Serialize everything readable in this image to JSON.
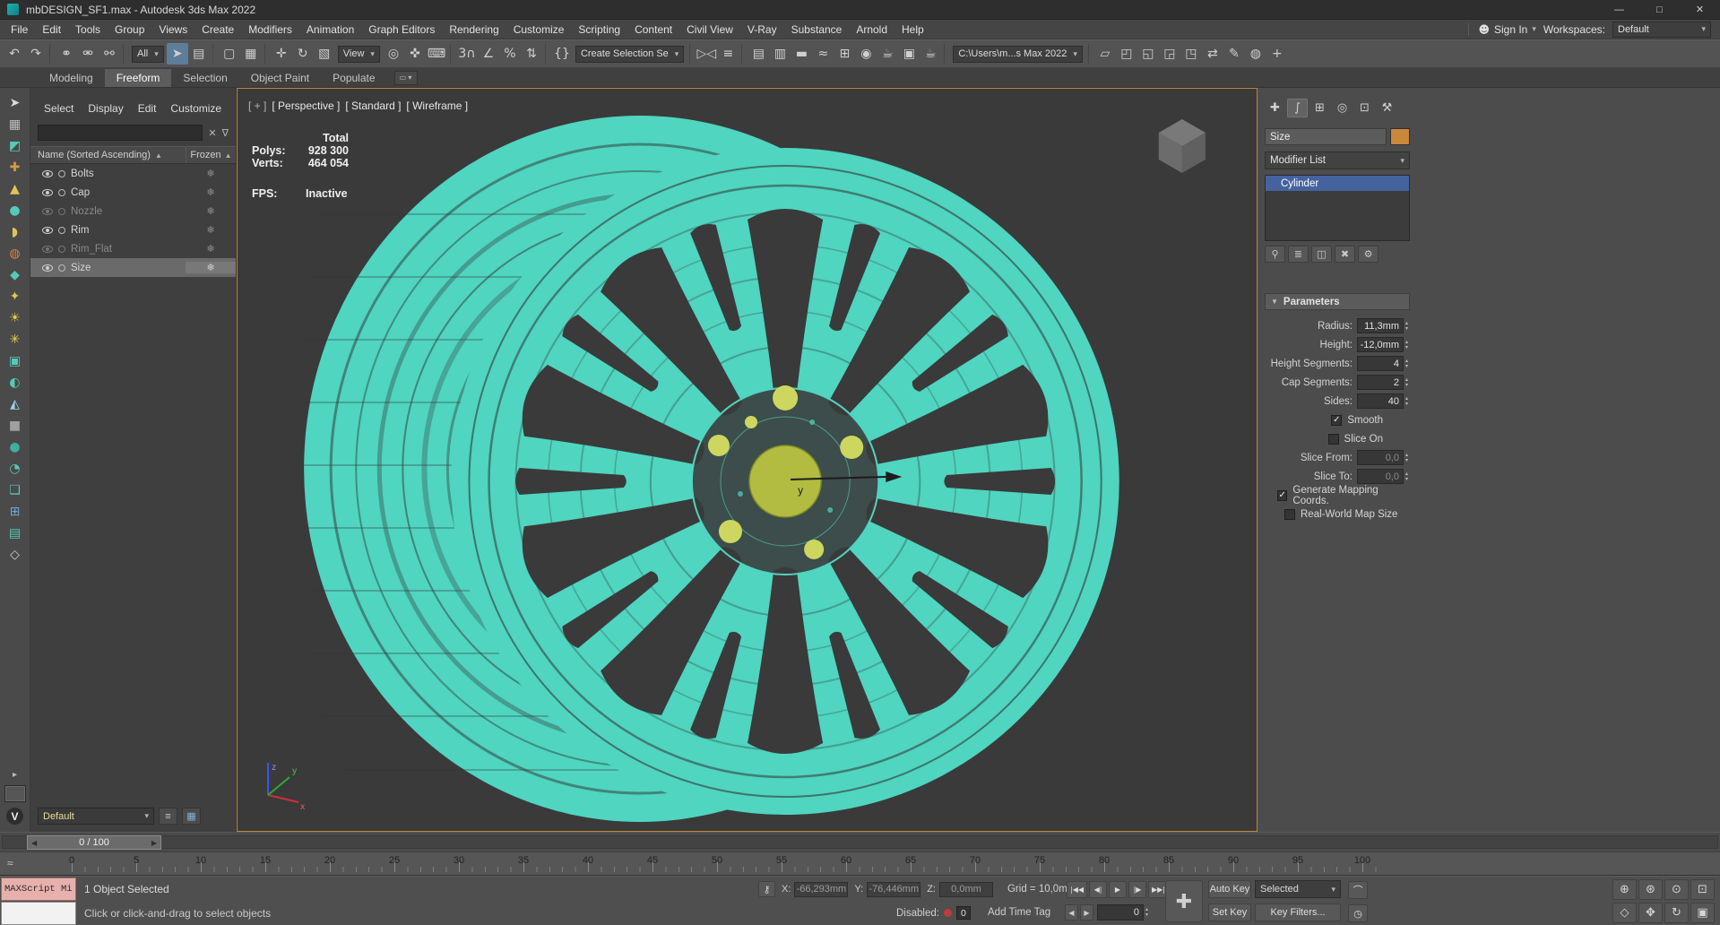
{
  "colors": {
    "accent_teal": "#4fd5c0",
    "object_yellow": "#b2bc40",
    "selection_blue": "#44639e",
    "viewport_border": "#b9893c",
    "listener_pink": "#e8b0ac"
  },
  "window": {
    "title": "mbDESIGN_SF1.max - Autodesk 3ds Max 2022",
    "minimize": "—",
    "maximize": "□",
    "close": "✕"
  },
  "menubar": {
    "items": [
      {
        "n": "menu-file",
        "label": "File"
      },
      {
        "n": "menu-edit",
        "label": "Edit"
      },
      {
        "n": "menu-tools",
        "label": "Tools"
      },
      {
        "n": "menu-group",
        "label": "Group"
      },
      {
        "n": "menu-views",
        "label": "Views"
      },
      {
        "n": "menu-create",
        "label": "Create"
      },
      {
        "n": "menu-modifiers",
        "label": "Modifiers"
      },
      {
        "n": "menu-animation",
        "label": "Animation"
      },
      {
        "n": "menu-graph-editors",
        "label": "Graph Editors"
      },
      {
        "n": "menu-rendering",
        "label": "Rendering"
      },
      {
        "n": "menu-customize",
        "label": "Customize"
      },
      {
        "n": "menu-scripting",
        "label": "Scripting"
      },
      {
        "n": "menu-content",
        "label": "Content"
      },
      {
        "n": "menu-civil-view",
        "label": "Civil View"
      },
      {
        "n": "menu-vray",
        "label": "V-Ray"
      },
      {
        "n": "menu-substance",
        "label": "Substance"
      },
      {
        "n": "menu-arnold",
        "label": "Arnold"
      },
      {
        "n": "menu-help",
        "label": "Help"
      }
    ],
    "signin_label": "Sign In",
    "workspaces_label": "Workspaces:",
    "workspace_value": "Default"
  },
  "toolbar": {
    "items": [
      {
        "n": "undo-icon",
        "g": "↶"
      },
      {
        "n": "redo-icon",
        "g": "↷"
      },
      {
        "sep": "|"
      },
      {
        "n": "select-and-link-icon",
        "g": "⚭"
      },
      {
        "n": "unlink-selection-icon",
        "g": "⚮"
      },
      {
        "n": "bind-to-space-warp-icon",
        "g": "⚯"
      },
      {
        "sep": "|"
      },
      {
        "n": "selection-filter-dropdown",
        "dd": "All"
      },
      {
        "n": "select-object-icon",
        "g": "➤",
        "cls": "active"
      },
      {
        "n": "select-by-name-icon",
        "g": "▤"
      },
      {
        "sep": "|"
      },
      {
        "n": "rectangular-selection-region-icon",
        "g": "▢"
      },
      {
        "n": "window-crossing-toggle-icon",
        "g": "▦"
      },
      {
        "sep": "|"
      },
      {
        "n": "select-and-move-icon",
        "g": "✛"
      },
      {
        "n": "select-and-rotate-icon",
        "g": "↻"
      },
      {
        "n": "select-and-scale-icon",
        "g": "▧"
      },
      {
        "n": "reference-coordinate-dropdown",
        "dd": "View"
      },
      {
        "n": "use-pivot-point-center-icon",
        "g": "◎"
      },
      {
        "n": "select-and-manipulate-icon",
        "g": "✜"
      },
      {
        "n": "keyboard-shortcut-override-icon",
        "g": "⌨"
      },
      {
        "sep": "|"
      },
      {
        "n": "snaps-toggle-icon",
        "g": "3∩"
      },
      {
        "n": "angle-snap-toggle-icon",
        "g": "∠"
      },
      {
        "n": "percent-snap-toggle-icon",
        "g": "%"
      },
      {
        "n": "spinner-snap-toggle-icon",
        "g": "⇅"
      },
      {
        "sep": "|"
      },
      {
        "n": "edit-named-selection-sets-icon",
        "g": "{}"
      },
      {
        "n": "named-selection-sets-dropdown",
        "dd": "Create Selection Se"
      },
      {
        "sep": "|"
      },
      {
        "n": "mirror-icon",
        "g": "▷◁"
      },
      {
        "n": "align-icon",
        "g": "≡"
      },
      {
        "sep": "|"
      },
      {
        "n": "toggle-scene-explorer-icon",
        "g": "▤"
      },
      {
        "n": "toggle-layer-explorer-icon",
        "g": "▥"
      },
      {
        "n": "toggle-ribbon-icon",
        "g": "▬"
      },
      {
        "n": "curve-editor-icon",
        "g": "≈"
      },
      {
        "n": "schematic-view-icon",
        "g": "⊞"
      },
      {
        "n": "material-editor-icon",
        "g": "◉"
      },
      {
        "n": "render-setup-icon",
        "g": "☕"
      },
      {
        "n": "rendered-frame-window-icon",
        "g": "▣"
      },
      {
        "n": "render-production-icon",
        "g": "☕"
      },
      {
        "sep": "|"
      },
      {
        "n": "project-folder-dropdown",
        "dd": "C:\\Users\\m...s Max 2022"
      },
      {
        "sep": "|"
      },
      {
        "n": "toggle-containers-icon",
        "g": "▱"
      },
      {
        "n": "open-container-icon",
        "g": "◰"
      },
      {
        "n": "save-container-icon",
        "g": "◱"
      },
      {
        "n": "inherit-container-icon",
        "g": "◲"
      },
      {
        "n": "edit-container-icon",
        "g": "◳"
      },
      {
        "n": "scene-converter-icon",
        "g": "⇄"
      },
      {
        "n": "civil-view-icon",
        "g": "✎"
      },
      {
        "n": "vray-frame-buffer-icon",
        "g": "◍"
      },
      {
        "n": "add-custom-toolbar-icon",
        "g": "+"
      }
    ]
  },
  "ribbon": {
    "tabs": [
      "Modeling",
      "Freeform",
      "Selection",
      "Object Paint",
      "Populate"
    ]
  },
  "left_toolbar": {
    "items": [
      {
        "n": "left-toolbar-select-icon",
        "g": "➤",
        "c": "#dcdcdc"
      },
      {
        "n": "left-toolbar-icon",
        "g": "▦",
        "c": "#c2c2c2"
      },
      {
        "n": "left-toolbar-icon",
        "g": "◩",
        "c": "#56c9b8"
      },
      {
        "n": "left-toolbar-icon",
        "g": "✚",
        "c": "#d89a3c"
      },
      {
        "n": "left-toolbar-icon",
        "g": "▲",
        "c": "#e0c455"
      },
      {
        "n": "left-toolbar-icon",
        "g": "●",
        "c": "#56c9b8"
      },
      {
        "n": "left-toolbar-icon",
        "g": "◗",
        "c": "#e0c455"
      },
      {
        "n": "left-toolbar-icon",
        "g": "◍",
        "c": "#d8823c"
      },
      {
        "n": "left-toolbar-icon",
        "g": "◆",
        "c": "#56c9b8"
      },
      {
        "n": "left-toolbar-icon",
        "g": "✦",
        "c": "#e0c455"
      },
      {
        "n": "left-toolbar-icon",
        "g": "☀",
        "c": "#e8c93f"
      },
      {
        "n": "left-toolbar-icon",
        "g": "✳",
        "c": "#e8d258"
      },
      {
        "n": "left-toolbar-icon",
        "g": "▣",
        "c": "#56c9b8"
      },
      {
        "n": "left-toolbar-icon",
        "g": "◐",
        "c": "#56c9b8"
      },
      {
        "n": "left-toolbar-icon",
        "g": "◭",
        "c": "#9cd2e8"
      },
      {
        "n": "left-toolbar-icon",
        "g": "■",
        "c": "#a0a0a0"
      },
      {
        "n": "left-toolbar-icon",
        "g": "●",
        "c": "#3fae9e"
      },
      {
        "n": "left-toolbar-icon",
        "g": "◔",
        "c": "#56c9b8"
      },
      {
        "n": "left-toolbar-icon",
        "g": "❏",
        "c": "#56c9b8"
      },
      {
        "n": "left-toolbar-icon",
        "g": "⊞",
        "c": "#6fa7cf"
      },
      {
        "n": "left-toolbar-icon",
        "g": "▤",
        "c": "#56c9b8"
      },
      {
        "n": "left-toolbar-icon",
        "g": "◇",
        "c": "#cccccc"
      }
    ],
    "expand_arrow": "▸",
    "vray_label": "V"
  },
  "explorer": {
    "menus": [
      "Select",
      "Display",
      "Edit",
      "Customize"
    ],
    "clear_glyph": "✕",
    "filter_glyph": "∇",
    "name_header": "Name (Sorted Ascending)",
    "frozen_header": "Frozen",
    "sort_arrow": "▲",
    "frozen_glyph": "❄",
    "rows": [
      {
        "name": "Bolts"
      },
      {
        "name": "Cap"
      },
      {
        "name": "Nozzle"
      },
      {
        "name": "Rim"
      },
      {
        "name": "Rim_Flat"
      },
      {
        "name": "Size"
      }
    ],
    "layer_value": "Default",
    "list_types_glyph": "≡",
    "settings_glyph": "▦"
  },
  "viewport": {
    "labels": {
      "plus": "[ + ]",
      "pov": "[ Perspective ]",
      "standard": "[ Standard ]",
      "shading": "[ Wireframe ]"
    },
    "stats": {
      "total": "Total",
      "polys_label": "Polys:",
      "polys": "928 300",
      "verts_label": "Verts:",
      "verts": "464 054",
      "fps_label": "FPS:",
      "fps_value": "Inactive"
    },
    "gizmo_axis": "y",
    "axis_x": "x",
    "axis_y": "y",
    "axis_z": "z"
  },
  "command_panel": {
    "tabs": [
      {
        "n": "tab-create",
        "g": "✚"
      },
      {
        "n": "tab-modify",
        "g": "∫",
        "cls": "active"
      },
      {
        "n": "tab-hierarchy",
        "g": "⊞"
      },
      {
        "n": "tab-motion",
        "g": "◎"
      },
      {
        "n": "tab-display",
        "g": "⊡"
      },
      {
        "n": "tab-utilities",
        "g": "⚒"
      }
    ],
    "object_name": "Size",
    "modifier_list_label": "Modifier List",
    "stack_item": "Cylinder",
    "stack_buttons": [
      {
        "n": "pin-stack-icon",
        "g": "⚲"
      },
      {
        "n": "show-end-result-icon",
        "g": "≣"
      },
      {
        "n": "make-unique-icon",
        "g": "◫"
      },
      {
        "n": "remove-modifier-icon",
        "g": "✖"
      },
      {
        "n": "configure-modifier-sets-icon",
        "g": "⚙"
      }
    ],
    "params": {
      "title": "Parameters",
      "radius_label": "Radius:",
      "radius_value": "11,3mm",
      "height_label": "Height:",
      "height_value": "-12,0mm",
      "height_segments_label": "Height Segments:",
      "height_segments_value": "4",
      "cap_segments_label": "Cap Segments:",
      "cap_segments_value": "2",
      "sides_label": "Sides:",
      "sides_value": "40",
      "smooth_label": "Smooth",
      "slice_on_label": "Slice On",
      "slice_from_label": "Slice From:",
      "slice_from_value": "0,0",
      "slice_to_label": "Slice To:",
      "slice_to_value": "0,0",
      "gen_mapping_label": "Generate Mapping Coords.",
      "real_world_label": "Real-World Map Size"
    }
  },
  "timeline": {
    "slider_label": "0 / 100",
    "nub_left": "◀",
    "nub_right": "▶",
    "mini_curve_glyph": "≈",
    "frames": [
      "0",
      "5",
      "10",
      "15",
      "20",
      "25",
      "30",
      "35",
      "40",
      "45",
      "50",
      "55",
      "60",
      "65",
      "70",
      "75",
      "80",
      "85",
      "90",
      "95",
      "100"
    ]
  },
  "statusbar": {
    "listener_text": "MAXScript Mi",
    "selection_status": "1 Object Selected",
    "prompt": "Click or click-and-drag to select objects",
    "lock_glyph": "⚷",
    "x_label": "X:",
    "x_value": "-66,293mm",
    "y_label": "Y:",
    "y_value": "-76,446mm",
    "z_label": "Z:",
    "z_value": "0,0mm",
    "grid": "Grid = 10,0mm",
    "script_status_label": "Disabled:",
    "script_status_value": "0",
    "add_time_tag": "Add Time Tag",
    "playback": [
      {
        "n": "go-to-start-button",
        "g": "|◀◀"
      },
      {
        "n": "previous-frame-button",
        "g": "◀|"
      },
      {
        "n": "play-button",
        "g": "▶"
      },
      {
        "n": "next-frame-button",
        "g": "|▶"
      },
      {
        "n": "go-to-end-button",
        "g": "▶▶|"
      }
    ],
    "big_key": "✚",
    "auto_key": "Auto Key",
    "set_key": "Set Key",
    "selected_dd": "Selected",
    "key_filters": "Key Filters...",
    "tangents_glyph": "⌒",
    "time_config_glyph": "◷",
    "prev_tiny": "◀",
    "next_tiny": "▶",
    "time_value": "0",
    "nav_row1": [
      {
        "n": "zoom-icon",
        "g": "⊕"
      },
      {
        "n": "zoom-all-icon",
        "g": "⊛"
      },
      {
        "n": "zoom-extents-icon",
        "g": "⊙"
      },
      {
        "n": "zoom-region-icon",
        "g": "⊡"
      }
    ],
    "nav_row2": [
      {
        "n": "field-of-view-icon",
        "g": "◇"
      },
      {
        "n": "pan-view-icon",
        "g": "✥"
      },
      {
        "n": "orbit-icon",
        "g": "↻"
      },
      {
        "n": "maximize-viewport-toggle-icon",
        "g": "▣"
      }
    ]
  }
}
